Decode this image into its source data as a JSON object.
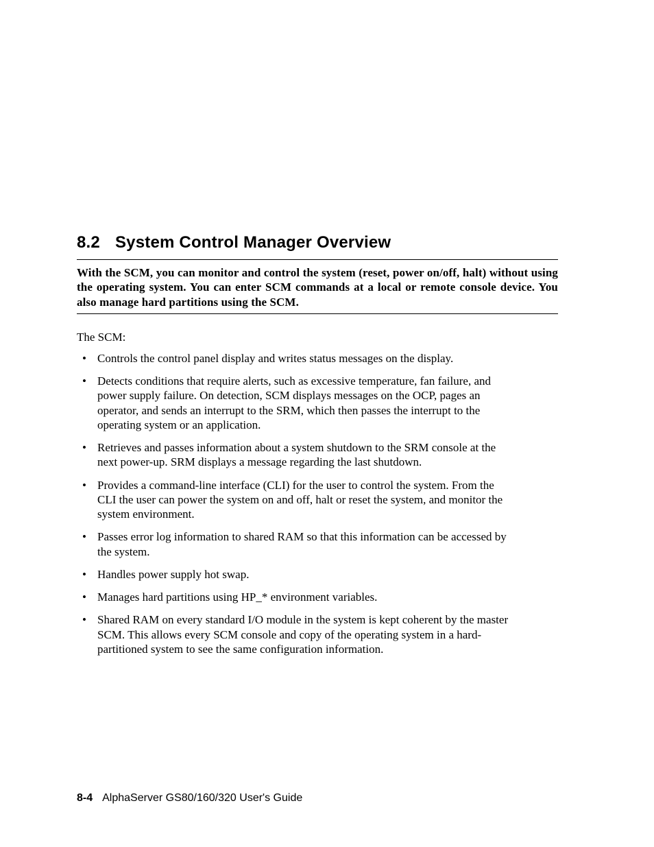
{
  "section": {
    "number": "8.2",
    "title": "System Control Manager Overview"
  },
  "intro": "With the SCM, you can monitor and control the system (reset, power on/off, halt) without using the operating system.  You can enter SCM commands at a local or remote console device.  You also manage hard partitions using the SCM.",
  "lead": "The SCM:",
  "bullets": [
    "Controls the control panel display and writes status messages on the display.",
    "Detects conditions that require alerts, such as excessive temperature, fan failure, and power supply failure.  On detection, SCM displays messages on the OCP, pages an operator, and sends an interrupt to the SRM, which then passes the interrupt to the operating system or an application.",
    "Retrieves and passes information about a system shutdown to the SRM console at the next power-up.  SRM displays a message regarding the last shutdown.",
    "Provides a command-line interface (CLI) for the user to control the system.  From the CLI the user can power the system on and off, halt or reset the system, and monitor the system environment.",
    "Passes error log information to shared RAM so that this information can be accessed by the system.",
    "Handles power supply hot swap.",
    "Manages hard partitions using HP_* environment variables.",
    "Shared RAM on every standard I/O module in the system is kept coherent by the master SCM.  This allows every SCM console and copy of the operating system in a hard-partitioned system to see the same configuration information."
  ],
  "footer": {
    "page": "8-4",
    "doc": "AlphaServer GS80/160/320 User's Guide"
  }
}
